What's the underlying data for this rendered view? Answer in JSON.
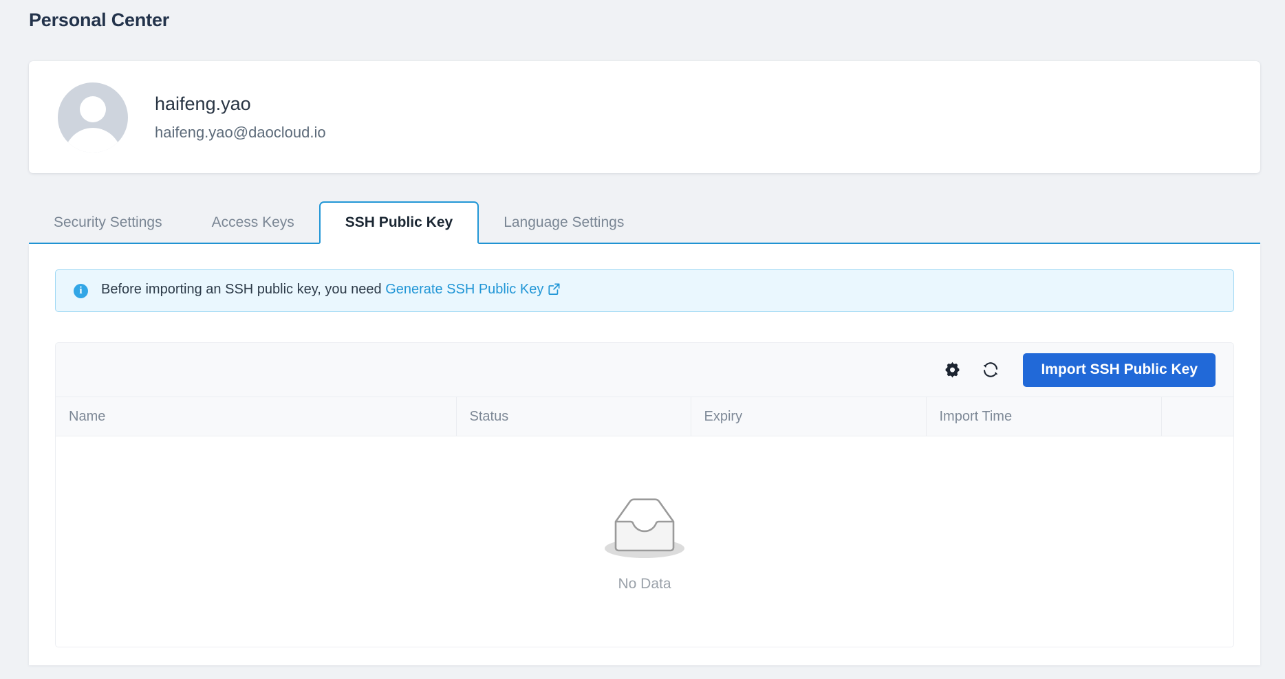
{
  "page": {
    "title": "Personal Center"
  },
  "profile": {
    "avatar_icon": "user-avatar-icon",
    "name": "haifeng.yao",
    "email": "haifeng.yao@daocloud.io"
  },
  "tabs": [
    {
      "label": "Security Settings",
      "active": false
    },
    {
      "label": "Access Keys",
      "active": false
    },
    {
      "label": "SSH Public Key",
      "active": true
    },
    {
      "label": "Language Settings",
      "active": false
    }
  ],
  "info_banner": {
    "icon": "info-circle-icon",
    "text": "Before importing an SSH public key, you need",
    "link_label": "Generate SSH Public Key",
    "link_icon": "external-link-icon"
  },
  "toolbar": {
    "settings_icon": "gear-icon",
    "refresh_icon": "refresh-icon",
    "import_label": "Import SSH Public Key"
  },
  "table": {
    "columns": [
      "Name",
      "Status",
      "Expiry",
      "Import Time",
      ""
    ],
    "rows": [],
    "empty": {
      "icon": "empty-inbox-icon",
      "label": "No Data"
    }
  },
  "colors": {
    "page_background": "#f0f2f5",
    "accent_blue": "#2196d6",
    "primary_button": "#2169d8",
    "banner_background": "#eaf7fe",
    "banner_border": "#9fd8f4",
    "title_text": "#23334b",
    "muted_text": "#7d8896"
  }
}
